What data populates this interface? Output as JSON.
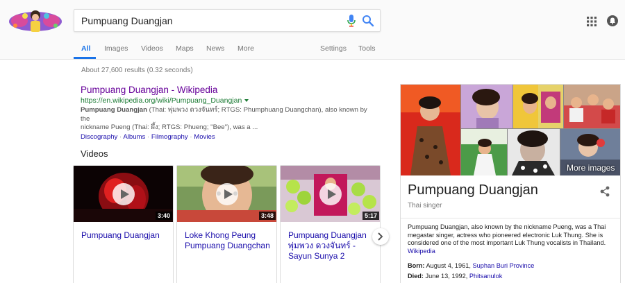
{
  "search": {
    "query": "Pumpuang Duangjan"
  },
  "tabs": {
    "all": "All",
    "images": "Images",
    "videos": "Videos",
    "maps": "Maps",
    "news": "News",
    "more": "More",
    "settings": "Settings",
    "tools": "Tools"
  },
  "stats": "About 27,600 results (0.32 seconds)",
  "result": {
    "title": "Pumpuang Duangjan - Wikipedia",
    "url": "https://en.wikipedia.org/wiki/Pumpuang_Duangjan",
    "snippet_bold": "Pumpuang Duangjan",
    "snippet_line1": " (Thai: พุ่มพวง ดวงจันทร์; RTGS: Phumphuang Duangchan), also known by the",
    "snippet_line2": "nickname Pueng (Thai: ผึ้ง; RTGS: Phueng; \"Bee\"), was a ...",
    "sitelinks": [
      "Discography",
      "Albums",
      "Filmography",
      "Movies"
    ],
    "sitelink_separator": "·"
  },
  "videos": {
    "heading": "Videos",
    "items": [
      {
        "title": "Pumpuang Duangjan",
        "duration": "3:40"
      },
      {
        "title": "Loke Khong Peung Pumpuang Duangchan",
        "duration": "3:48"
      },
      {
        "title": "Pumpuang Duangjan พุ่มพวง ดวงจันทร์ - Sayun Sunya 2",
        "duration": "5:17"
      }
    ]
  },
  "knowledge_panel": {
    "more_images": "More images",
    "title": "Pumpuang Duangjan",
    "subtitle": "Thai singer",
    "description": "Pumpuang Duangjan, also known by the nickname Pueng, was a Thai megastar singer, actress who pioneered electronic Luk Thung. She is considered one of the most important Luk Thung vocalists in Thailand.",
    "source": "Wikipedia",
    "born_label": "Born:",
    "born_value": "August 4, 1961,",
    "born_link": "Suphan Buri Province",
    "died_label": "Died:",
    "died_value": "June 13, 1992,",
    "died_link": "Phitsanulok"
  },
  "colors": {
    "link": "#1a0dab",
    "visited": "#660099",
    "url_green": "#1a7a33",
    "active_tab": "#1a73e8"
  }
}
